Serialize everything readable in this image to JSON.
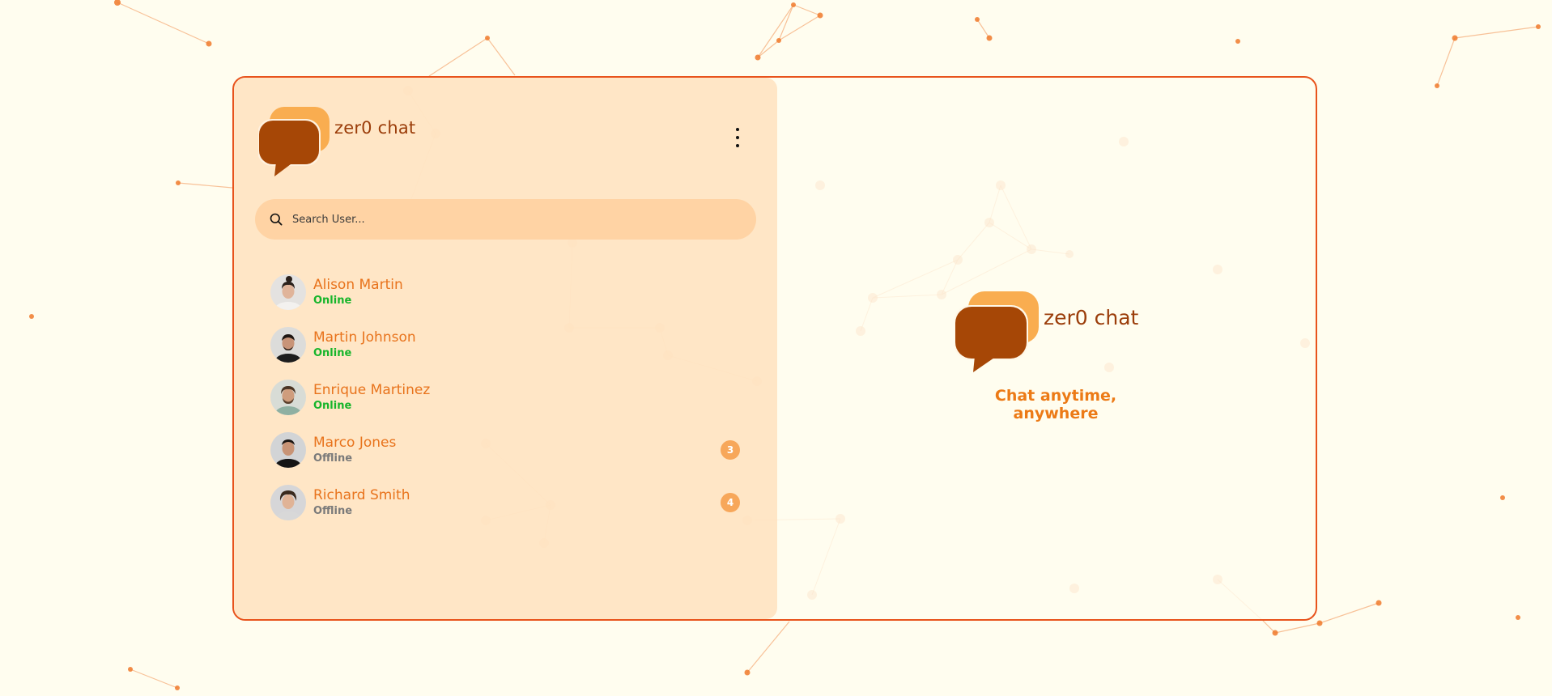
{
  "app": {
    "brand_name": "zer0 chat",
    "menu_icon": "kebab-menu-icon",
    "logo_icon": "chat-bubbles-logo-icon"
  },
  "search": {
    "placeholder": "Search User...",
    "icon": "search-icon"
  },
  "contacts": [
    {
      "name": "Alison Martin",
      "status": "Online",
      "unread": null
    },
    {
      "name": "Martin Johnson",
      "status": "Online",
      "unread": null
    },
    {
      "name": "Enrique Martinez",
      "status": "Online",
      "unread": null
    },
    {
      "name": "Marco Jones",
      "status": "Offline",
      "unread": "3"
    },
    {
      "name": "Richard Smith",
      "status": "Offline",
      "unread": "4"
    }
  ],
  "welcome": {
    "brand_name": "zer0 chat",
    "tagline": "Chat anytime, anywhere"
  },
  "colors": {
    "accent": "#e8731c",
    "brand_dark": "#a64706",
    "brand_light": "#f9ad50",
    "online": "#17b52b",
    "offline": "#7a7a7a",
    "border": "#e8531c",
    "background": "#fffdef",
    "sidebar": "#ffe2be",
    "search_bg": "#ffd3a4",
    "badge": "#f7a75a"
  }
}
